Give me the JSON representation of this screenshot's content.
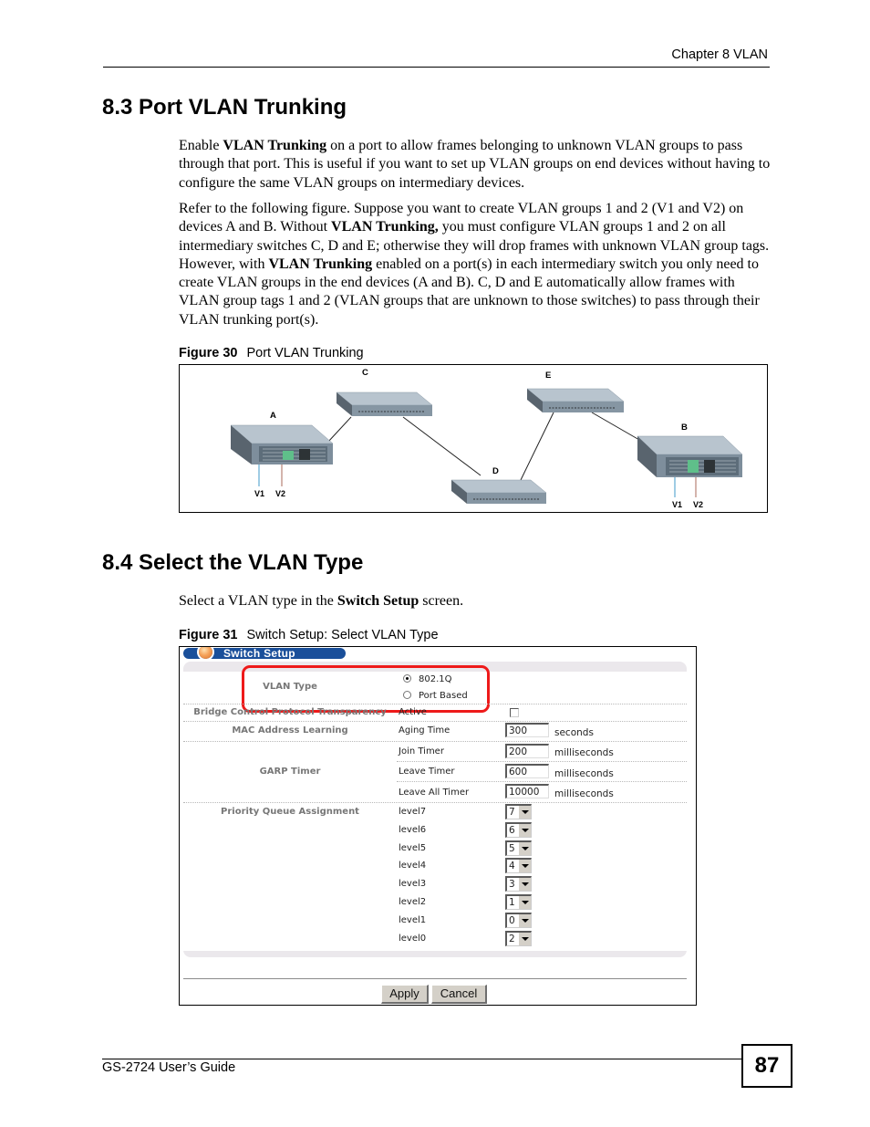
{
  "header": {
    "chapter": "Chapter 8 VLAN"
  },
  "section_8_3": {
    "heading": "8.3  Port VLAN Trunking",
    "paragraphs": [
      [
        {
          "t": "Enable ",
          "b": false
        },
        {
          "t": "VLAN Trunking",
          "b": true
        },
        {
          "t": " on a port to allow frames belonging to unknown VLAN groups to pass through that port. This is useful if you want to set up VLAN groups on end devices without having to configure the same VLAN groups on intermediary devices.",
          "b": false
        }
      ],
      [
        {
          "t": "Refer to the following figure. Suppose you want to create VLAN groups 1 and 2 (V1 and V2) on devices A and B. Without ",
          "b": false
        },
        {
          "t": "VLAN Trunking,",
          "b": true
        },
        {
          "t": " you must configure VLAN groups 1 and 2 on all intermediary switches C, D and E; otherwise they will drop frames with unknown VLAN group tags. However, with ",
          "b": false
        },
        {
          "t": "VLAN Trunking",
          "b": true
        },
        {
          "t": " enabled on a port(s) in each intermediary switch you only need to create VLAN groups in the end devices (A and B). C, D and E automatically allow frames with VLAN group tags 1 and 2 (VLAN groups that are unknown to those switches) to pass through their VLAN trunking port(s).",
          "b": false
        }
      ]
    ],
    "figure": {
      "number": "Figure 30",
      "caption": "Port VLAN Trunking",
      "labels": {
        "a": "A",
        "b": "B",
        "c": "C",
        "d": "D",
        "e": "E",
        "a_v1": "V1",
        "a_v2": "V2",
        "b_v1": "V1",
        "b_v2": "V2"
      }
    }
  },
  "section_8_4": {
    "heading": "8.4  Select the VLAN Type",
    "paragraph": [
      {
        "t": "Select a VLAN type in the ",
        "b": false
      },
      {
        "t": "Switch Setup",
        "b": true
      },
      {
        "t": " screen.",
        "b": false
      }
    ],
    "figure": {
      "number": "Figure 31",
      "caption": "Switch Setup: Select VLAN Type"
    }
  },
  "switch_setup": {
    "title": "Switch Setup",
    "vlan_type": {
      "label": "VLAN Type",
      "options": [
        {
          "label": "802.1Q",
          "selected": true
        },
        {
          "label": "Port Based",
          "selected": false
        }
      ]
    },
    "bpdu": {
      "label": "Bridge Control Protocol Transparency",
      "field": "Active",
      "checked": false
    },
    "mac_learning": {
      "label": "MAC Address Learning",
      "field": "Aging Time",
      "value": "300",
      "unit": "seconds"
    },
    "garp": {
      "label": "GARP Timer",
      "rows": [
        {
          "field": "Join Timer",
          "value": "200",
          "unit": "milliseconds"
        },
        {
          "field": "Leave Timer",
          "value": "600",
          "unit": "milliseconds"
        },
        {
          "field": "Leave All Timer",
          "value": "10000",
          "unit": "milliseconds"
        }
      ]
    },
    "priority_queue": {
      "label": "Priority Queue Assignment",
      "levels": [
        {
          "name": "level7",
          "value": "7"
        },
        {
          "name": "level6",
          "value": "6"
        },
        {
          "name": "level5",
          "value": "5"
        },
        {
          "name": "level4",
          "value": "4"
        },
        {
          "name": "level3",
          "value": "3"
        },
        {
          "name": "level2",
          "value": "1"
        },
        {
          "name": "level1",
          "value": "0"
        },
        {
          "name": "level0",
          "value": "2"
        }
      ]
    },
    "buttons": {
      "apply": "Apply",
      "cancel": "Cancel"
    },
    "highlight_color": "#ee1a1a",
    "title_bar_color": "#1a4f9a"
  },
  "footer": {
    "guide": "GS-2724 User’s Guide",
    "page_number": "87"
  }
}
